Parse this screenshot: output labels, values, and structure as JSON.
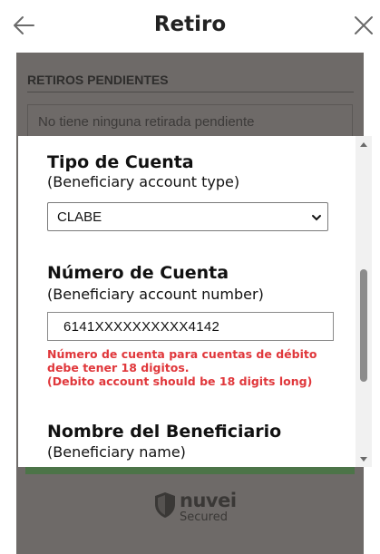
{
  "header": {
    "title": "Retiro",
    "back_icon": "arrow-left-icon",
    "close_icon": "close-icon"
  },
  "pending": {
    "heading": "RETIROS PENDIENTES",
    "empty_message": "No tiene ninguna retirada pendiente"
  },
  "form": {
    "account_type": {
      "label": "Tipo de Cuenta",
      "sublabel": "(Beneficiary account type)",
      "selected": "CLABE"
    },
    "account_number": {
      "label": "Número de Cuenta",
      "sublabel": "(Beneficiary account number)",
      "value": "6141XXXXXXXXXX4142",
      "error_lines": [
        "Número de cuenta para cuentas de débito",
        "debe tener 18 digitos.",
        "(Debito account should be 18 digits long)"
      ]
    },
    "beneficiary_name": {
      "label": "Nombre del Beneficiario",
      "sublabel": "(Beneficiary name)"
    }
  },
  "branding": {
    "name": "nuvei",
    "tagline": "Secured"
  },
  "colors": {
    "error": "#e0373b",
    "overlay": "#6e6a68",
    "accent_green": "#4c7448"
  }
}
